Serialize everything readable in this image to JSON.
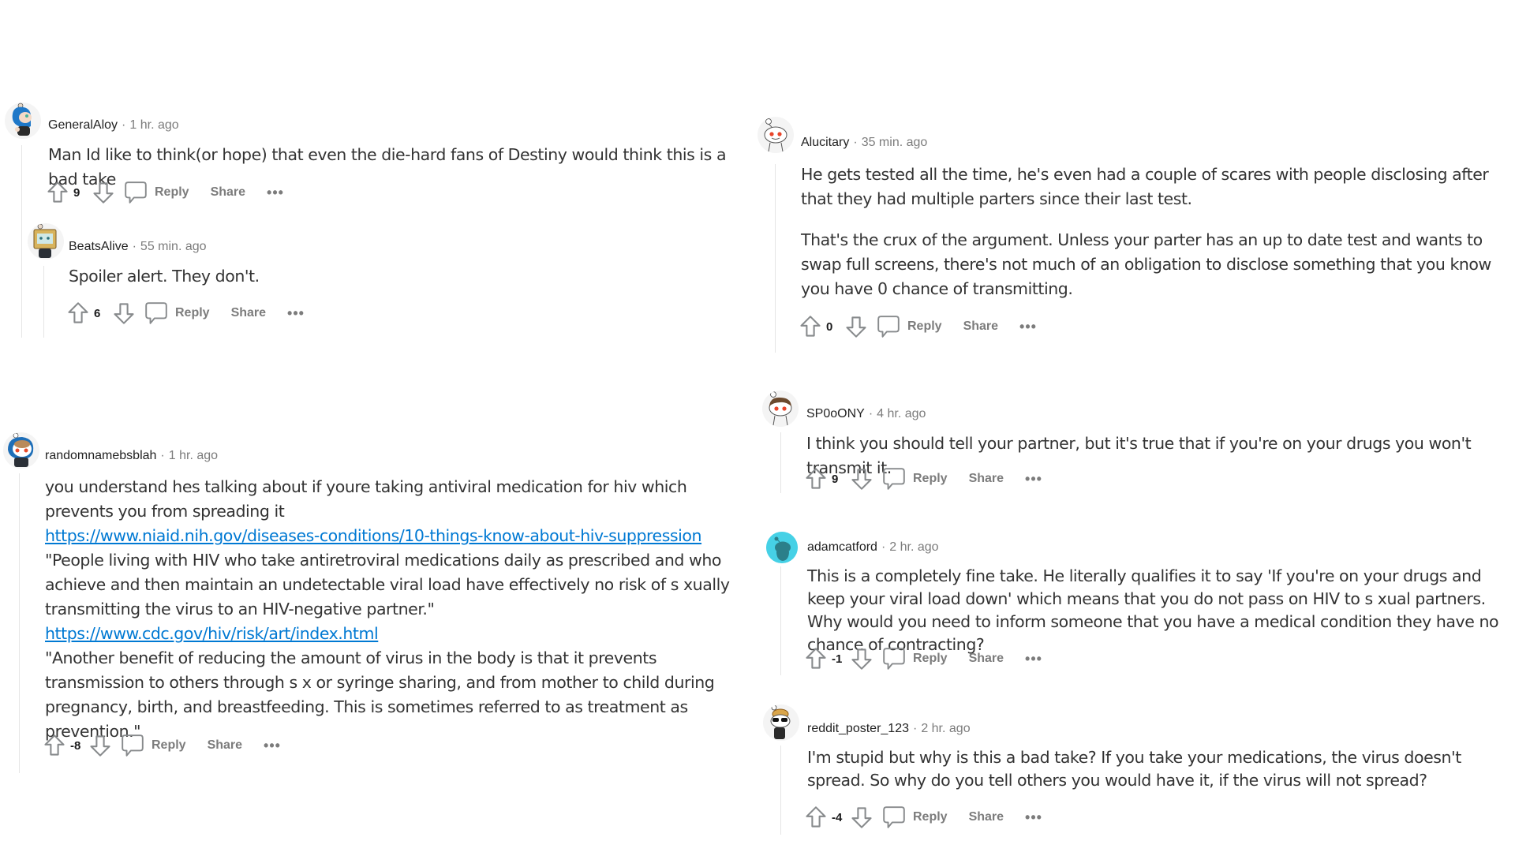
{
  "actions": {
    "reply_label": "Reply",
    "share_label": "Share",
    "more_label": "•••"
  },
  "icons": {
    "upvote": "upvote-arrow-icon",
    "downvote": "downvote-arrow-icon",
    "comment": "speech-bubble-icon",
    "more": "ellipsis-icon"
  },
  "colors": {
    "link": "#0079d3",
    "meta_gray": "#7c7c7c",
    "body_text": "#333333",
    "thread_line": "#e5e5e5"
  },
  "comments": [
    {
      "username": "GeneralAloy",
      "time": "1 hr. ago",
      "avatar": "snoo-blue-hair-avatar",
      "paragraphs": [
        "Man Id like to think(or hope) that even the die-hard fans of Destiny would think this is a bad take"
      ],
      "score": "9"
    },
    {
      "username": "BeatsAlive",
      "time": "55 min. ago",
      "avatar": "snoo-tv-head-avatar",
      "paragraphs": [
        "Spoiler alert. They don't."
      ],
      "score": "6"
    },
    {
      "username": "randomnamebsblah",
      "time": "1 hr. ago",
      "avatar": "snoo-hooded-avatar",
      "paragraphs": [
        "you understand hes talking about if youre taking antiviral medication for hiv which prevents you from spreading it"
      ],
      "link1": "https://www.niaid.nih.gov/diseases-conditions/10-things-know-about-hiv-suppression",
      "quote1": "\"People living with HIV who take antiretroviral medications daily as prescribed and who achieve and then maintain an undetectable viral load have effectively no risk of s  xually transmitting the virus to an HIV-negative partner.\"",
      "link2": "https://www.cdc.gov/hiv/risk/art/index.html",
      "quote2": "\"Another benefit of reducing the amount of virus in the body is that it prevents transmission to others through s  x or syringe sharing, and from mother to child during pregnancy, birth, and breastfeeding. This is sometimes referred to as treatment as prevention.\"",
      "score": "-8"
    },
    {
      "username": "Alucitary",
      "time": "35 min. ago",
      "avatar": "snoo-default-avatar",
      "paragraphs": [
        "He gets tested all the time, he's even had a couple of scares with people disclosing after that they had multiple parters since their last test.",
        "That's the crux of the argument. Unless your parter has an up to date test and wants to swap full screens, there's not much of an obligation to disclose something that you know you have 0 chance of transmitting."
      ],
      "score": "0"
    },
    {
      "username": "SP0oONY",
      "time": "4 hr. ago",
      "avatar": "snoo-brown-hair-avatar",
      "paragraphs": [
        "I think you should tell your partner, but it's true that if you're on your drugs you won't transmit it."
      ],
      "score": "9"
    },
    {
      "username": "adamcatford",
      "time": "2 hr. ago",
      "avatar": "snoo-cyan-circle-avatar",
      "paragraphs": [
        "This is a completely fine take. He literally qualifies it to say 'If you're on your drugs and keep your viral load down' which means that you do not pass on HIV to s  xual partners. Why would you need to inform someone that you have a medical condition they have no chance of contracting?"
      ],
      "score": "-1"
    },
    {
      "username": "reddit_poster_123",
      "time": "2 hr. ago",
      "avatar": "snoo-sunglasses-avatar",
      "paragraphs": [
        "I'm stupid but why is this a bad take? If you take your medications, the virus doesn't spread. So why do you tell others you would have it, if the virus will not spread?"
      ],
      "score": "-4"
    }
  ]
}
